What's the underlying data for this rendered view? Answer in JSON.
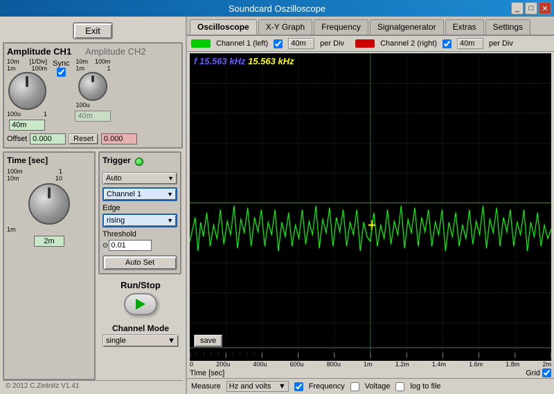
{
  "window": {
    "title": "Soundcard Oszilloscope",
    "controls": [
      "_",
      "□",
      "✕"
    ]
  },
  "tabs": [
    {
      "label": "Oscilloscope",
      "active": true
    },
    {
      "label": "X-Y Graph",
      "active": false
    },
    {
      "label": "Frequency",
      "active": false
    },
    {
      "label": "Signalgenerator",
      "active": false
    },
    {
      "label": "Extras",
      "active": false
    },
    {
      "label": "Settings",
      "active": false
    }
  ],
  "channel_bar": {
    "ch1_label": "Channel 1 (left)",
    "ch1_per_div": "40m",
    "ch1_per_div_label": "per Div",
    "ch2_label": "Channel 2 (right)",
    "ch2_per_div": "40m",
    "ch2_per_div_label": "per Div"
  },
  "freq_display": {
    "prefix": "f",
    "value1": "15.563",
    "unit1": "kHz",
    "value2": "15.563",
    "unit2": "kHz"
  },
  "left_panel": {
    "exit_label": "Exit",
    "amplitude": {
      "ch1_label": "Amplitude CH1",
      "ch2_label": "Amplitude CH2",
      "ch1_div_label": "[1/Div]",
      "ch1_knob_top_left": "10m",
      "ch1_knob_top_right": "100m",
      "ch1_knob_bottom_left": "1m",
      "ch1_knob_bottom_right": "1",
      "ch1_knob_bottom_left2": "100u",
      "ch1_value": "40m",
      "sync_label": "Sync",
      "ch2_knob_top_left": "10m",
      "ch2_knob_top_right": "100m",
      "ch2_knob_bottom_left": "1m",
      "ch2_knob_bottom_right": "1",
      "ch2_knob_bottom_left2": "100u",
      "ch2_value": "40m",
      "offset_label": "Offset",
      "offset_ch1_value": "0.000",
      "reset_label": "Reset",
      "offset_ch2_value": "0.000"
    },
    "time": {
      "title": "Time [sec]",
      "knob_top_left": "100m",
      "knob_top_right": "1",
      "knob_bottom_left": "10m",
      "knob_bottom_right": "10",
      "knob_bottom_left2": "1m",
      "value": "2m"
    },
    "trigger": {
      "title": "Trigger",
      "mode": "Auto",
      "channel": "Channel 1",
      "edge_label": "Edge",
      "edge_value": "rising",
      "threshold_label": "Threshold",
      "threshold_value": "0.01",
      "autoset_label": "Auto Set"
    },
    "run_stop": {
      "label": "Run/Stop"
    },
    "channel_mode": {
      "label": "Channel Mode",
      "value": "single",
      "arrow": "▼"
    },
    "copyright": "© 2012  C.Zeitnitz V1.41"
  },
  "measure_bar": {
    "label": "Measure",
    "dropdown": "Hz and volts",
    "frequency_label": "Frequency",
    "voltage_label": "Voltage",
    "log_label": "log to file"
  },
  "axis": {
    "time_labels": [
      "0",
      "200u",
      "400u",
      "600u",
      "800u",
      "1m",
      "1.2m",
      "1.4m",
      "1.6m",
      "1.8m",
      "2m"
    ],
    "time_title": "Time [sec]",
    "grid_label": "Grid"
  }
}
